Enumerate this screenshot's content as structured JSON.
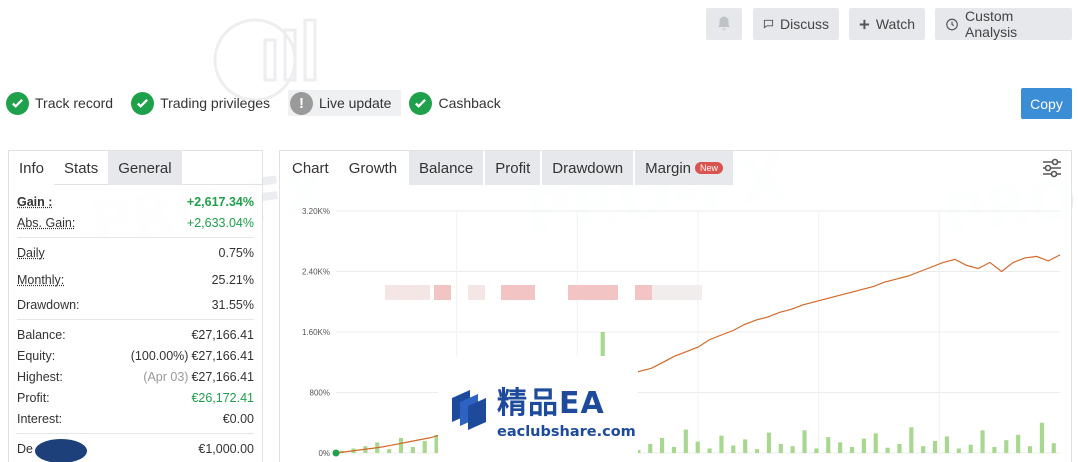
{
  "topbar": {
    "discuss_label": "Discuss",
    "watch_label": "Watch",
    "custom_analysis_label": "Custom Analysis"
  },
  "status": {
    "items": [
      {
        "label": "Track record",
        "state": "ok"
      },
      {
        "label": "Trading privileges",
        "state": "ok"
      },
      {
        "label": "Live update",
        "state": "warn"
      },
      {
        "label": "Cashback",
        "state": "ok"
      }
    ],
    "copy_label": "Copy"
  },
  "left_panel": {
    "tabs": [
      "Info",
      "Stats",
      "General"
    ],
    "rows": [
      {
        "label": "Gain :",
        "value": "+2,617.34%"
      },
      {
        "label": "Abs. Gain:",
        "value": "+2,633.04%"
      },
      {
        "label": "Daily",
        "value": "0.75%"
      },
      {
        "label": "Monthly:",
        "value": "25.21%"
      },
      {
        "label": "Drawdown:",
        "value": "31.55%"
      },
      {
        "label": "Balance:",
        "value": "€27,166.41"
      },
      {
        "label": "Equity:",
        "prefix": "(100.00%)",
        "value": "€27,166.41"
      },
      {
        "label": "Highest:",
        "prefix": "(Apr 03)",
        "value": "€27,166.41"
      },
      {
        "label": "Profit:",
        "value": "€26,172.41"
      },
      {
        "label": "Interest:",
        "value": "€0.00"
      },
      {
        "label": "De",
        "value": "€1,000.00"
      }
    ]
  },
  "right_panel": {
    "tabs": [
      "Chart",
      "Growth",
      "Balance",
      "Profit",
      "Drawdown",
      "Margin"
    ],
    "new_badge": "New"
  },
  "chart_data": {
    "type": "line",
    "y_ticks": [
      "0%",
      "800%",
      "1.60K%",
      "2.40K%",
      "3.20K%"
    ],
    "ylim": [
      0,
      3200
    ],
    "series": [
      {
        "color": "#d2692a",
        "values": [
          0,
          20,
          40,
          60,
          80,
          110,
          140,
          170,
          200,
          240,
          280,
          320,
          360,
          420,
          470,
          520,
          560,
          620,
          680,
          720,
          780,
          850,
          900,
          960,
          1000,
          1040,
          1080,
          1120,
          1200,
          1280,
          1340,
          1400,
          1500,
          1560,
          1620,
          1700,
          1760,
          1800,
          1860,
          1900,
          1960,
          2000,
          2040,
          2080,
          2120,
          2160,
          2200,
          2260,
          2300,
          2340,
          2400,
          2460,
          2520,
          2560,
          2480,
          2440,
          2520,
          2400,
          2520,
          2580,
          2600,
          2540,
          2620
        ]
      }
    ],
    "bars": {
      "color": "#a8d88f",
      "values": [
        30,
        60,
        90,
        140,
        50,
        200,
        80,
        160,
        240,
        120,
        60,
        100,
        280,
        90,
        180,
        220,
        70,
        130,
        300,
        60,
        100,
        150,
        1600,
        90,
        260,
        40,
        120,
        200,
        80,
        310,
        150,
        60,
        230,
        100,
        180,
        50,
        270,
        120,
        90,
        300,
        60,
        210,
        140,
        80,
        190,
        260,
        70,
        120,
        340,
        90,
        160,
        220,
        60,
        110,
        300,
        80,
        170,
        240,
        90,
        400,
        130
      ]
    }
  },
  "logo": {
    "text_main": "精品EA",
    "text_sub": "eaclubshare.com"
  }
}
